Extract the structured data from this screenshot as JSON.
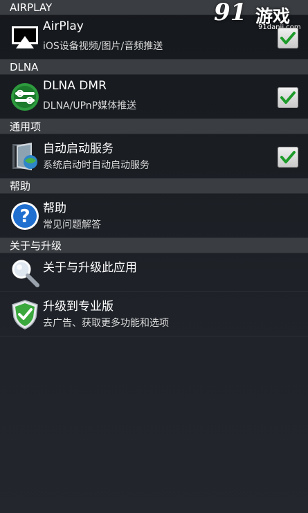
{
  "sections": {
    "airplay": {
      "header": "AIRPLAY",
      "item": {
        "title": "AirPlay",
        "subtitle": "iOS设备视频/图片/音频推送",
        "checked": true,
        "icon": "airplay-icon"
      }
    },
    "dlna": {
      "header": "DLNA",
      "item": {
        "title": "DLNA DMR",
        "subtitle": "DLNA/UPnP媒体推送",
        "checked": true,
        "icon": "dlna-icon"
      }
    },
    "general": {
      "header": "通用项",
      "item": {
        "title": "自动启动服务",
        "subtitle": "系统启动时自动启动服务",
        "checked": true,
        "icon": "autostart-icon"
      }
    },
    "help": {
      "header": "帮助",
      "item": {
        "title": "帮助",
        "subtitle": "常见问题解答",
        "icon": "question-icon"
      }
    },
    "about": {
      "header": "关于与升级",
      "items": [
        {
          "title": "关于与升级此应用",
          "icon": "magnifier-icon"
        },
        {
          "title": "升级到专业版",
          "subtitle": "去广告、获取更多功能和选项",
          "icon": "shield-check-icon"
        }
      ]
    }
  },
  "watermark": {
    "number": "91",
    "text": "游戏",
    "url": "91danji.com"
  },
  "colors": {
    "header_bg": "#3a3d41",
    "list_bg": "#1b1e23",
    "check_green": "#1e9b2a"
  }
}
